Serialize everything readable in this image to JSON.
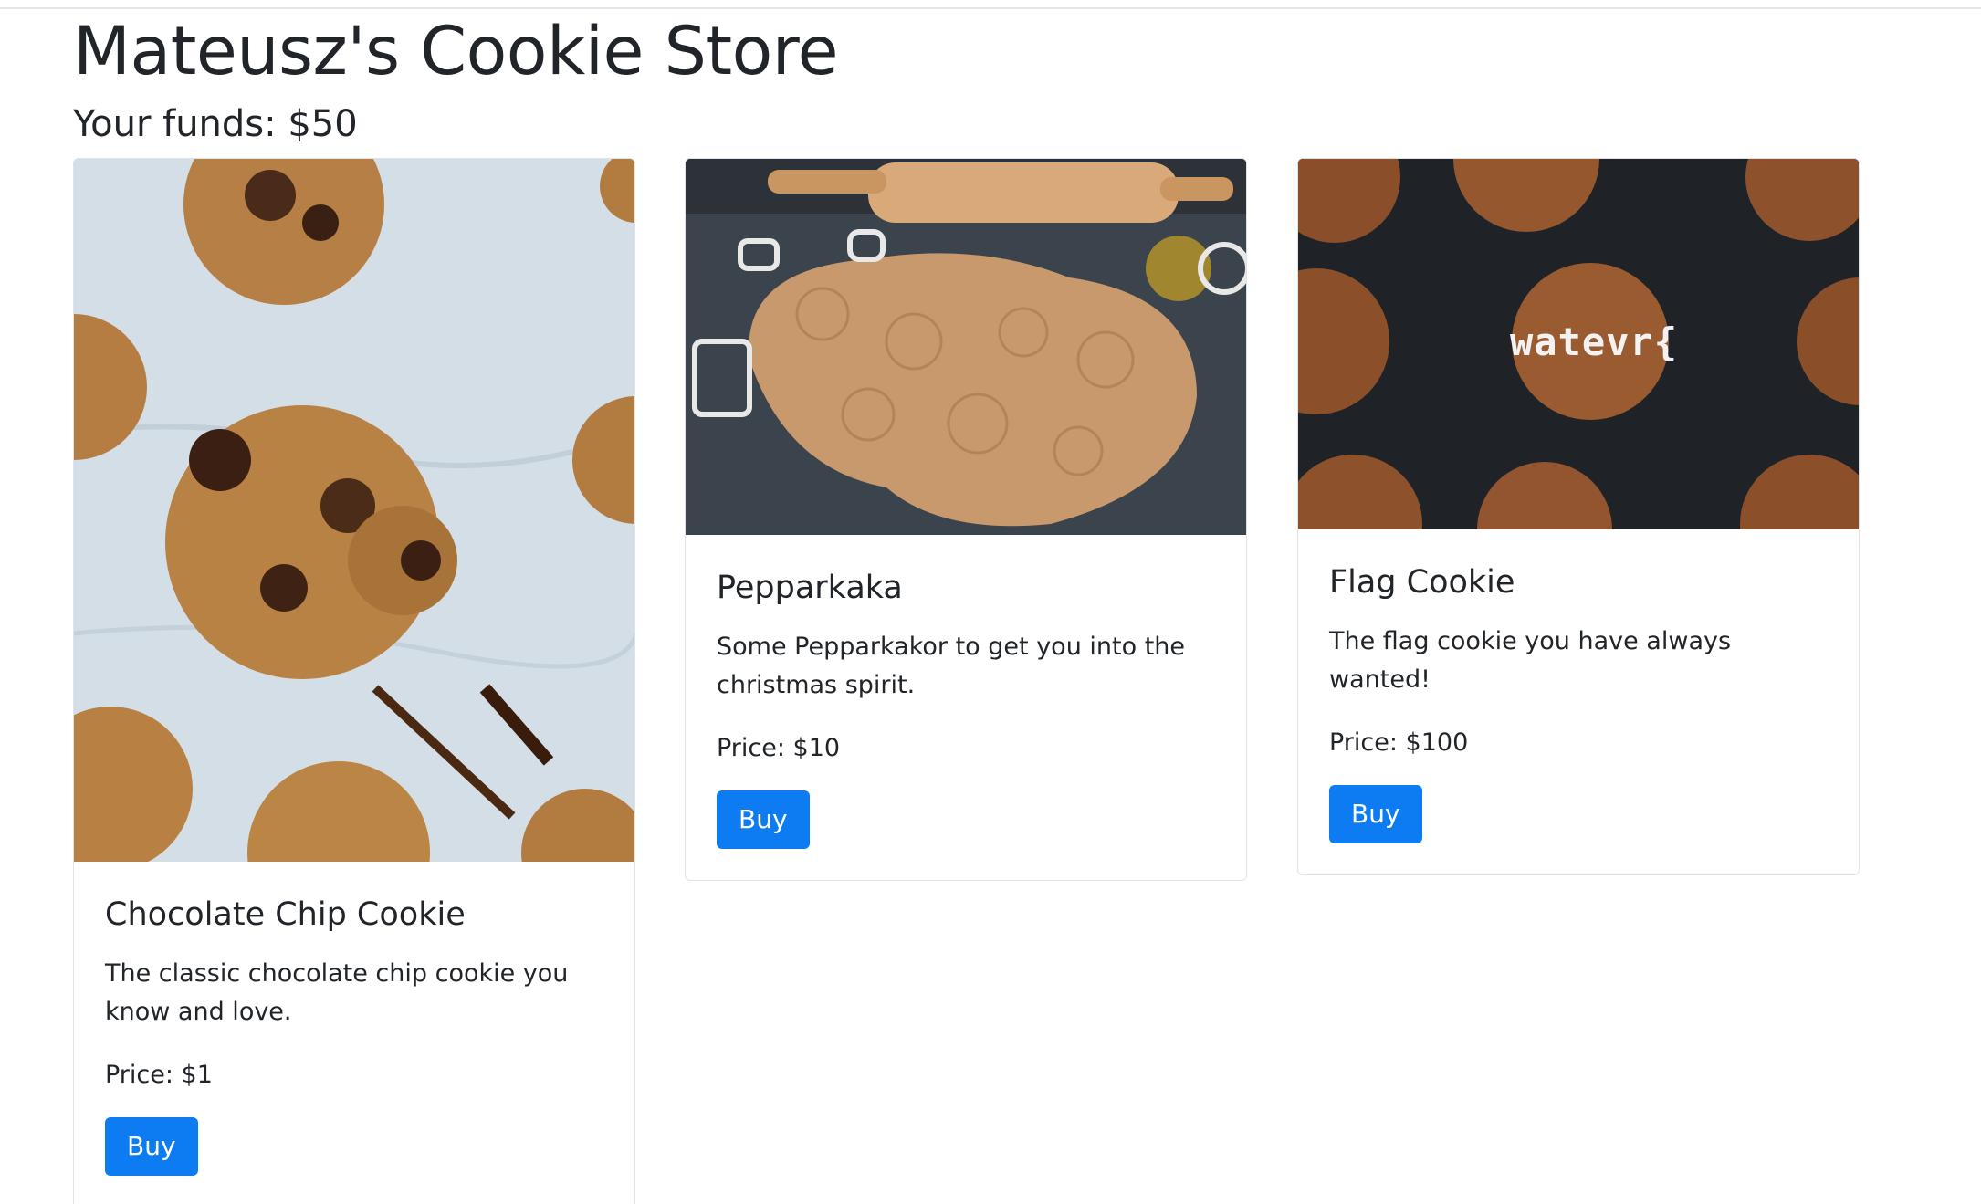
{
  "page": {
    "title": "Mateusz's Cookie Store",
    "funds_label": "Your funds: $50"
  },
  "products": [
    {
      "name": "Chocolate Chip Cookie",
      "description": "The classic chocolate chip cookie you know and love.",
      "price": "Price: $1",
      "buy_label": "Buy",
      "image": "chocolate-chip-cookies-photo"
    },
    {
      "name": "Pepparkaka",
      "description": "Some Pepparkakor to get you into the christmas spirit.",
      "price": "Price: $10",
      "buy_label": "Buy",
      "image": "gingerbread-dough-photo"
    },
    {
      "name": "Flag Cookie",
      "description": "The flag cookie you have always wanted!",
      "price": "Price: $100",
      "buy_label": "Buy",
      "image": "ginger-cookies-photo",
      "image_text": "watevr{"
    }
  ],
  "colors": {
    "button": "#0d7cf2",
    "text": "#212529",
    "card_border": "#dfe2e6"
  }
}
